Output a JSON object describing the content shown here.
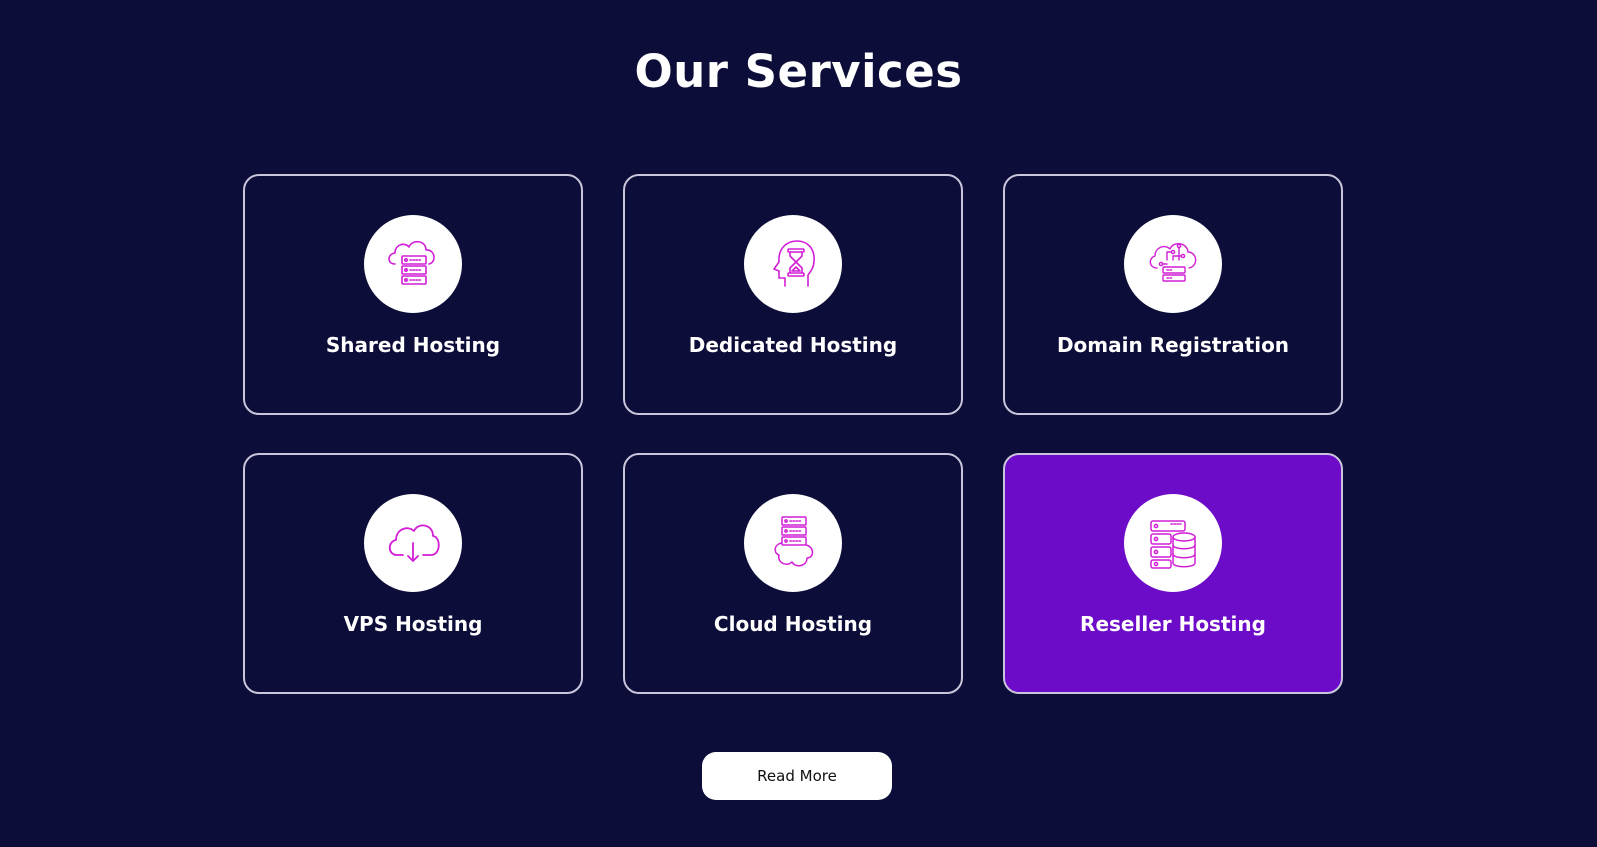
{
  "section": {
    "title": "Our Services"
  },
  "colors": {
    "background": "#0c0d38",
    "card_border": "#c9c6dc",
    "active_card": "#6c0bc8",
    "icon_stroke": "#d21ed6",
    "text": "#ffffff"
  },
  "services": [
    {
      "label": "Shared Hosting",
      "icon": "cloud-server-icon",
      "active": false
    },
    {
      "label": "Dedicated Hosting",
      "icon": "head-hourglass-icon",
      "active": false
    },
    {
      "label": "Domain Registration",
      "icon": "cloud-network-server-icon",
      "active": false
    },
    {
      "label": "VPS Hosting",
      "icon": "cloud-download-icon",
      "active": false
    },
    {
      "label": "Cloud Hosting",
      "icon": "server-cloud-icon",
      "active": false
    },
    {
      "label": "Reseller Hosting",
      "icon": "server-database-icon",
      "active": true
    }
  ],
  "cta": {
    "read_more_label": "Read More"
  }
}
